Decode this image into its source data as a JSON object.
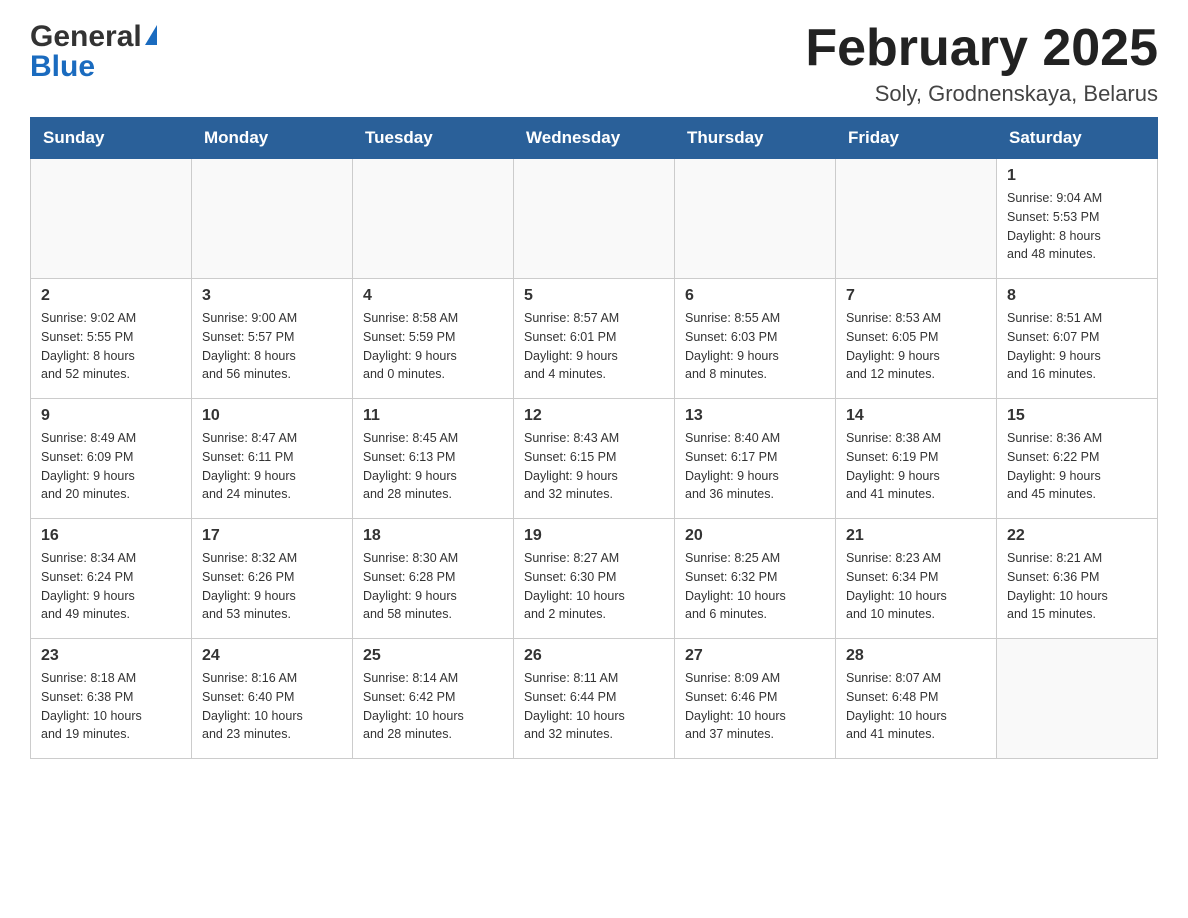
{
  "header": {
    "logo_general": "General",
    "logo_blue": "Blue",
    "title": "February 2025",
    "subtitle": "Soly, Grodnenskaya, Belarus"
  },
  "days_of_week": [
    "Sunday",
    "Monday",
    "Tuesday",
    "Wednesday",
    "Thursday",
    "Friday",
    "Saturday"
  ],
  "weeks": [
    [
      {
        "date": "",
        "info": ""
      },
      {
        "date": "",
        "info": ""
      },
      {
        "date": "",
        "info": ""
      },
      {
        "date": "",
        "info": ""
      },
      {
        "date": "",
        "info": ""
      },
      {
        "date": "",
        "info": ""
      },
      {
        "date": "1",
        "info": "Sunrise: 9:04 AM\nSunset: 5:53 PM\nDaylight: 8 hours\nand 48 minutes."
      }
    ],
    [
      {
        "date": "2",
        "info": "Sunrise: 9:02 AM\nSunset: 5:55 PM\nDaylight: 8 hours\nand 52 minutes."
      },
      {
        "date": "3",
        "info": "Sunrise: 9:00 AM\nSunset: 5:57 PM\nDaylight: 8 hours\nand 56 minutes."
      },
      {
        "date": "4",
        "info": "Sunrise: 8:58 AM\nSunset: 5:59 PM\nDaylight: 9 hours\nand 0 minutes."
      },
      {
        "date": "5",
        "info": "Sunrise: 8:57 AM\nSunset: 6:01 PM\nDaylight: 9 hours\nand 4 minutes."
      },
      {
        "date": "6",
        "info": "Sunrise: 8:55 AM\nSunset: 6:03 PM\nDaylight: 9 hours\nand 8 minutes."
      },
      {
        "date": "7",
        "info": "Sunrise: 8:53 AM\nSunset: 6:05 PM\nDaylight: 9 hours\nand 12 minutes."
      },
      {
        "date": "8",
        "info": "Sunrise: 8:51 AM\nSunset: 6:07 PM\nDaylight: 9 hours\nand 16 minutes."
      }
    ],
    [
      {
        "date": "9",
        "info": "Sunrise: 8:49 AM\nSunset: 6:09 PM\nDaylight: 9 hours\nand 20 minutes."
      },
      {
        "date": "10",
        "info": "Sunrise: 8:47 AM\nSunset: 6:11 PM\nDaylight: 9 hours\nand 24 minutes."
      },
      {
        "date": "11",
        "info": "Sunrise: 8:45 AM\nSunset: 6:13 PM\nDaylight: 9 hours\nand 28 minutes."
      },
      {
        "date": "12",
        "info": "Sunrise: 8:43 AM\nSunset: 6:15 PM\nDaylight: 9 hours\nand 32 minutes."
      },
      {
        "date": "13",
        "info": "Sunrise: 8:40 AM\nSunset: 6:17 PM\nDaylight: 9 hours\nand 36 minutes."
      },
      {
        "date": "14",
        "info": "Sunrise: 8:38 AM\nSunset: 6:19 PM\nDaylight: 9 hours\nand 41 minutes."
      },
      {
        "date": "15",
        "info": "Sunrise: 8:36 AM\nSunset: 6:22 PM\nDaylight: 9 hours\nand 45 minutes."
      }
    ],
    [
      {
        "date": "16",
        "info": "Sunrise: 8:34 AM\nSunset: 6:24 PM\nDaylight: 9 hours\nand 49 minutes."
      },
      {
        "date": "17",
        "info": "Sunrise: 8:32 AM\nSunset: 6:26 PM\nDaylight: 9 hours\nand 53 minutes."
      },
      {
        "date": "18",
        "info": "Sunrise: 8:30 AM\nSunset: 6:28 PM\nDaylight: 9 hours\nand 58 minutes."
      },
      {
        "date": "19",
        "info": "Sunrise: 8:27 AM\nSunset: 6:30 PM\nDaylight: 10 hours\nand 2 minutes."
      },
      {
        "date": "20",
        "info": "Sunrise: 8:25 AM\nSunset: 6:32 PM\nDaylight: 10 hours\nand 6 minutes."
      },
      {
        "date": "21",
        "info": "Sunrise: 8:23 AM\nSunset: 6:34 PM\nDaylight: 10 hours\nand 10 minutes."
      },
      {
        "date": "22",
        "info": "Sunrise: 8:21 AM\nSunset: 6:36 PM\nDaylight: 10 hours\nand 15 minutes."
      }
    ],
    [
      {
        "date": "23",
        "info": "Sunrise: 8:18 AM\nSunset: 6:38 PM\nDaylight: 10 hours\nand 19 minutes."
      },
      {
        "date": "24",
        "info": "Sunrise: 8:16 AM\nSunset: 6:40 PM\nDaylight: 10 hours\nand 23 minutes."
      },
      {
        "date": "25",
        "info": "Sunrise: 8:14 AM\nSunset: 6:42 PM\nDaylight: 10 hours\nand 28 minutes."
      },
      {
        "date": "26",
        "info": "Sunrise: 8:11 AM\nSunset: 6:44 PM\nDaylight: 10 hours\nand 32 minutes."
      },
      {
        "date": "27",
        "info": "Sunrise: 8:09 AM\nSunset: 6:46 PM\nDaylight: 10 hours\nand 37 minutes."
      },
      {
        "date": "28",
        "info": "Sunrise: 8:07 AM\nSunset: 6:48 PM\nDaylight: 10 hours\nand 41 minutes."
      },
      {
        "date": "",
        "info": ""
      }
    ]
  ]
}
